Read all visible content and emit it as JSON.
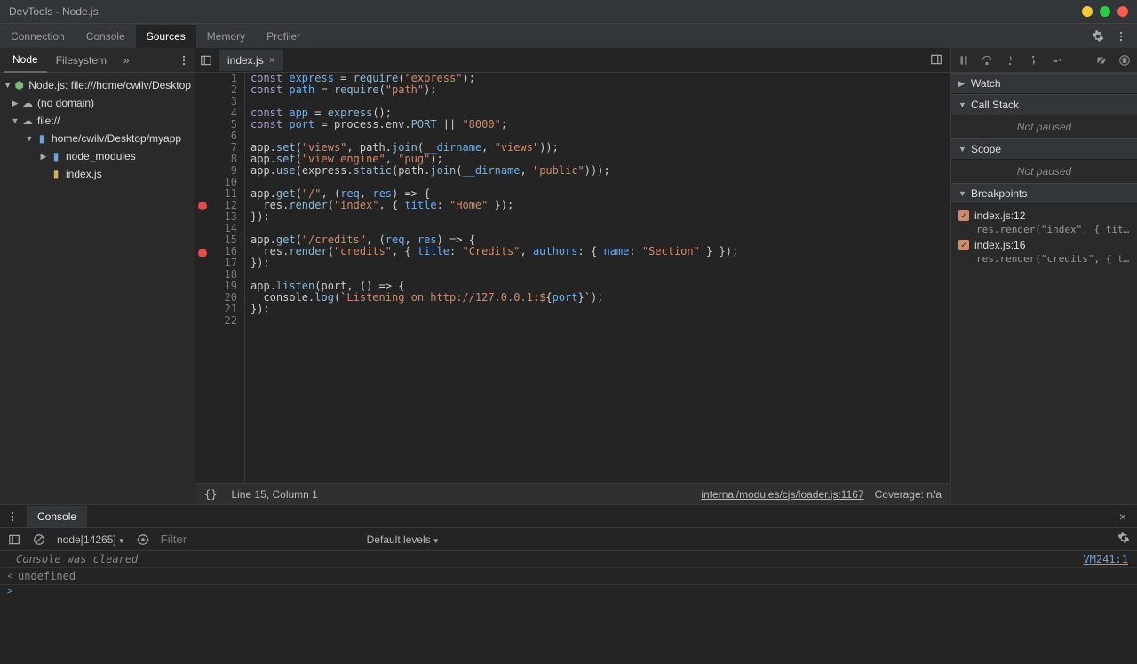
{
  "titlebar": {
    "title": "DevTools - Node.js"
  },
  "mainTabs": {
    "items": [
      "Connection",
      "Console",
      "Sources",
      "Memory",
      "Profiler"
    ],
    "active": "Sources"
  },
  "leftPanel": {
    "tabs": {
      "items": [
        "Node",
        "Filesystem"
      ],
      "active": "Node"
    },
    "tree": {
      "root": "Node.js: file:///home/cwilv/Desktop",
      "nodomain": "(no domain)",
      "fileScheme": "file://",
      "projectPath": "home/cwilv/Desktop/myapp",
      "nodeModules": "node_modules",
      "indexFile": "index.js"
    }
  },
  "editor": {
    "openFile": "index.js",
    "lines": 22,
    "breakpoints": [
      12,
      16
    ],
    "code": [
      [
        [
          "kw",
          "const"
        ],
        [
          "op",
          " "
        ],
        [
          "var",
          "express"
        ],
        [
          "op",
          " = "
        ],
        [
          "prop",
          "require"
        ],
        [
          "op",
          "("
        ],
        [
          "str",
          "\"express\""
        ],
        [
          "op",
          ");"
        ]
      ],
      [
        [
          "kw",
          "const"
        ],
        [
          "op",
          " "
        ],
        [
          "var",
          "path"
        ],
        [
          "op",
          " = "
        ],
        [
          "prop",
          "require"
        ],
        [
          "op",
          "("
        ],
        [
          "str",
          "\"path\""
        ],
        [
          "op",
          ");"
        ]
      ],
      [],
      [
        [
          "kw",
          "const"
        ],
        [
          "op",
          " "
        ],
        [
          "var",
          "app"
        ],
        [
          "op",
          " = "
        ],
        [
          "prop",
          "express"
        ],
        [
          "op",
          "();"
        ]
      ],
      [
        [
          "kw",
          "const"
        ],
        [
          "op",
          " "
        ],
        [
          "var",
          "port"
        ],
        [
          "op",
          " = process.env."
        ],
        [
          "prop",
          "PORT"
        ],
        [
          "op",
          " || "
        ],
        [
          "str",
          "\"8000\""
        ],
        [
          "op",
          ";"
        ]
      ],
      [],
      [
        [
          "op",
          "app."
        ],
        [
          "prop",
          "set"
        ],
        [
          "op",
          "("
        ],
        [
          "str",
          "\"views\""
        ],
        [
          "op",
          ", path."
        ],
        [
          "prop",
          "join"
        ],
        [
          "op",
          "("
        ],
        [
          "var",
          "__dirname"
        ],
        [
          "op",
          ", "
        ],
        [
          "str",
          "\"views\""
        ],
        [
          "op",
          "));"
        ]
      ],
      [
        [
          "op",
          "app."
        ],
        [
          "prop",
          "set"
        ],
        [
          "op",
          "("
        ],
        [
          "str",
          "\"view engine\""
        ],
        [
          "op",
          ", "
        ],
        [
          "str",
          "\"pug\""
        ],
        [
          "op",
          ");"
        ]
      ],
      [
        [
          "op",
          "app."
        ],
        [
          "prop",
          "use"
        ],
        [
          "op",
          "(express."
        ],
        [
          "prop",
          "static"
        ],
        [
          "op",
          "(path."
        ],
        [
          "prop",
          "join"
        ],
        [
          "op",
          "("
        ],
        [
          "var",
          "__dirname"
        ],
        [
          "op",
          ", "
        ],
        [
          "str",
          "\"public\""
        ],
        [
          "op",
          ")));"
        ]
      ],
      [],
      [
        [
          "op",
          "app."
        ],
        [
          "prop",
          "get"
        ],
        [
          "op",
          "("
        ],
        [
          "str",
          "\"/\""
        ],
        [
          "op",
          ", ("
        ],
        [
          "var",
          "req"
        ],
        [
          "op",
          ", "
        ],
        [
          "var",
          "res"
        ],
        [
          "op",
          ") => {"
        ]
      ],
      [
        [
          "op",
          "  res."
        ],
        [
          "prop",
          "render"
        ],
        [
          "op",
          "("
        ],
        [
          "str",
          "\"index\""
        ],
        [
          "op",
          ", { "
        ],
        [
          "var",
          "title"
        ],
        [
          "op",
          ": "
        ],
        [
          "str",
          "\"Home\""
        ],
        [
          "op",
          " });"
        ]
      ],
      [
        [
          "op",
          "});"
        ]
      ],
      [],
      [
        [
          "op",
          "app."
        ],
        [
          "prop",
          "get"
        ],
        [
          "op",
          "("
        ],
        [
          "str",
          "\"/credits\""
        ],
        [
          "op",
          ", ("
        ],
        [
          "var",
          "req"
        ],
        [
          "op",
          ", "
        ],
        [
          "var",
          "res"
        ],
        [
          "op",
          ") => {"
        ]
      ],
      [
        [
          "op",
          "  res."
        ],
        [
          "prop",
          "render"
        ],
        [
          "op",
          "("
        ],
        [
          "str",
          "\"credits\""
        ],
        [
          "op",
          ", { "
        ],
        [
          "var",
          "title"
        ],
        [
          "op",
          ": "
        ],
        [
          "str",
          "\"Credits\""
        ],
        [
          "op",
          ", "
        ],
        [
          "var",
          "authors"
        ],
        [
          "op",
          ": { "
        ],
        [
          "var",
          "name"
        ],
        [
          "op",
          ": "
        ],
        [
          "str",
          "\"Section\""
        ],
        [
          "op",
          " } });"
        ]
      ],
      [
        [
          "op",
          "});"
        ]
      ],
      [],
      [
        [
          "op",
          "app."
        ],
        [
          "prop",
          "listen"
        ],
        [
          "op",
          "(port, () => {"
        ]
      ],
      [
        [
          "op",
          "  console."
        ],
        [
          "prop",
          "log"
        ],
        [
          "op",
          "(`"
        ],
        [
          "str",
          "Listening on http://127.0.0.1:$"
        ],
        [
          "op",
          "{"
        ],
        [
          "var",
          "port"
        ],
        [
          "op",
          "}"
        ],
        [
          "str",
          ""
        ],
        [
          "op",
          "`);"
        ]
      ],
      [
        [
          "op",
          "});"
        ]
      ],
      []
    ]
  },
  "statusbar": {
    "position": "Line 15, Column 1",
    "loader": "internal/modules/cjs/loader.js:1167",
    "coverage": "Coverage: n/a"
  },
  "rightPanel": {
    "sections": {
      "watch": {
        "title": "Watch",
        "expanded": false
      },
      "callstack": {
        "title": "Call Stack",
        "expanded": true,
        "content": "Not paused"
      },
      "scope": {
        "title": "Scope",
        "expanded": true,
        "content": "Not paused"
      },
      "breakpoints": {
        "title": "Breakpoints",
        "expanded": true,
        "items": [
          {
            "label": "index.js:12",
            "code": "res.render(\"index\", { title…",
            "checked": true
          },
          {
            "label": "index.js:16",
            "code": "res.render(\"credits\", { tit…",
            "checked": true
          }
        ]
      }
    }
  },
  "console": {
    "tab": "Console",
    "context": "node[14265]",
    "filterPlaceholder": "Filter",
    "levels": "Default levels",
    "cleared": "Console was cleared",
    "clearedSource": "VM241:1",
    "lastOutput": "undefined"
  }
}
